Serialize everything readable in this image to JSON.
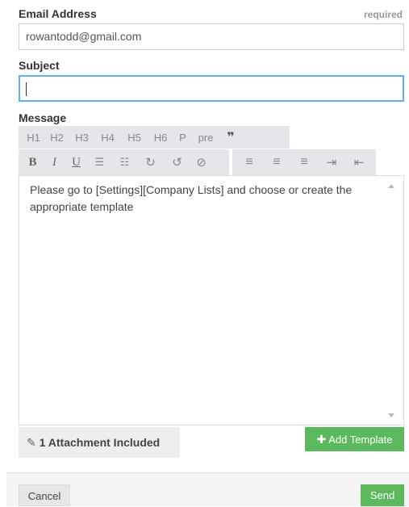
{
  "email": {
    "label": "Email Address",
    "required_hint": "required",
    "value": "rowantodd@gmail.com"
  },
  "subject": {
    "label": "Subject",
    "value": ""
  },
  "message": {
    "label": "Message",
    "headings_toolbar": [
      "H1",
      "H2",
      "H3",
      "H4",
      "H5",
      "H6",
      "P",
      "pre"
    ],
    "quote_icon": "blockquote-icon",
    "format_toolbar": [
      {
        "glyph": "B",
        "icon": "bold-icon"
      },
      {
        "glyph": "I",
        "icon": "italic-icon"
      },
      {
        "glyph": "U",
        "icon": "underline-icon"
      },
      {
        "glyph": "☰",
        "icon": "unordered-list-icon"
      },
      {
        "glyph": "☷",
        "icon": "ordered-list-icon"
      },
      {
        "glyph": "↻",
        "icon": "redo-icon"
      },
      {
        "glyph": "↺",
        "icon": "undo-icon"
      },
      {
        "glyph": "⊘",
        "icon": "clear-format-icon"
      },
      {
        "glyph": "≡",
        "icon": "align-left-icon"
      },
      {
        "glyph": "≡",
        "icon": "align-center-icon"
      },
      {
        "glyph": "≡",
        "icon": "align-right-icon"
      },
      {
        "glyph": "⇥",
        "icon": "indent-icon"
      },
      {
        "glyph": "⇤",
        "icon": "outdent-icon"
      }
    ],
    "body": "Please go to [Settings][Company Lists] and choose or create the appropriate template"
  },
  "attachment": {
    "icon": "paperclip-icon",
    "label": "1 Attachment Included"
  },
  "add_template": {
    "icon": "plus-icon",
    "label": "Add Template"
  },
  "footer": {
    "cancel_label": "Cancel",
    "send_label": "Send"
  },
  "colors": {
    "green": "#5cb85c",
    "focus_border": "#66afe9",
    "toolbar_bg": "#e5e5ea"
  }
}
